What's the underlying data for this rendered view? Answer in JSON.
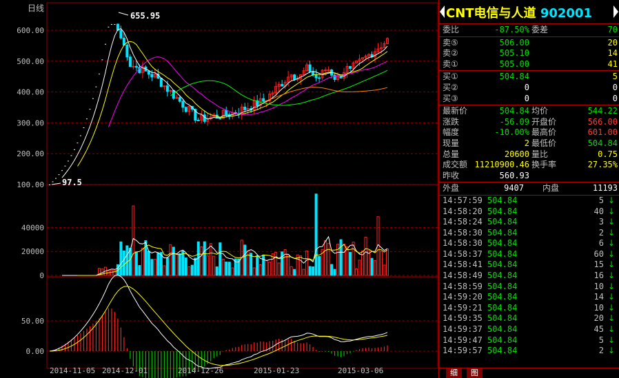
{
  "chart": {
    "period_label": "日线",
    "price_axis": [
      "600.00",
      "500.00",
      "400.00",
      "300.00",
      "200.00",
      "100.00"
    ],
    "volume_axis": [
      "40000",
      "20000",
      "0"
    ],
    "macd_axis": [
      "50.00",
      "0.00"
    ],
    "high_label": "655.95",
    "low_label": "97.5",
    "dates": [
      "2014-11-05",
      "2014-12-01",
      "2014-12-26",
      "2015-01-23",
      "2015-03-06"
    ],
    "colors": {
      "up": "#ff2020",
      "down": "#00e5ff",
      "ma5": "#ffffff",
      "ma10": "#ffff00",
      "ma20": "#ff00ff",
      "ma60": "#00ff00",
      "ma120": "#ff8000",
      "grid": "#8b0000"
    }
  },
  "quote": {
    "name": "CNT电信与人道",
    "code": "902001",
    "weibi_label": "委比",
    "weibi": "-87.50%",
    "weicha_label": "委差",
    "weicha": "70",
    "sell": [
      {
        "label": "卖⑤",
        "price": "506.00",
        "vol": "20"
      },
      {
        "label": "卖②",
        "price": "505.10",
        "vol": "14"
      },
      {
        "label": "卖①",
        "price": "505.00",
        "vol": "41"
      }
    ],
    "buy": [
      {
        "label": "买①",
        "price": "504.84",
        "vol": "5"
      },
      {
        "label": "买②",
        "price": "0",
        "vol": "0"
      },
      {
        "label": "买③",
        "price": "0",
        "vol": "0"
      }
    ],
    "stats": [
      {
        "l1": "最新价",
        "v1": "504.84",
        "l2": "均价",
        "v2": "544.22"
      },
      {
        "l1": "涨跌",
        "v1": "-56.09",
        "l2": "开盘价",
        "v2": "566.00"
      },
      {
        "l1": "幅度",
        "v1": "-10.00%",
        "l2": "最高价",
        "v2": "601.00"
      },
      {
        "l1": "现量",
        "v1": "2",
        "l2": "最低价",
        "v2": "504.84"
      },
      {
        "l1": "总量",
        "v1": "20600",
        "l2": "量比",
        "v2": "0.75"
      },
      {
        "l1": "成交额",
        "v1": "11210900.46",
        "l2": "换手率",
        "v2": "27.35%"
      }
    ],
    "prev_close_label": "昨收",
    "prev_close": "560.93",
    "outer_label": "外盘",
    "outer": "9407",
    "inner_label": "内盘",
    "inner": "11193"
  },
  "ticks": [
    {
      "time": "14:57:59",
      "price": "504.84",
      "vol": "5",
      "dir": "↓"
    },
    {
      "time": "14:58:20",
      "price": "504.84",
      "vol": "40",
      "dir": "↓"
    },
    {
      "time": "14:58:24",
      "price": "504.84",
      "vol": "3",
      "dir": "↓"
    },
    {
      "time": "14:58:30",
      "price": "504.84",
      "vol": "2",
      "dir": "↓"
    },
    {
      "time": "14:58:30",
      "price": "504.84",
      "vol": "6",
      "dir": "↓"
    },
    {
      "time": "14:58:37",
      "price": "504.84",
      "vol": "60",
      "dir": "↓"
    },
    {
      "time": "14:58:41",
      "price": "504.84",
      "vol": "15",
      "dir": "↓"
    },
    {
      "time": "14:58:49",
      "price": "504.84",
      "vol": "16",
      "dir": "↓"
    },
    {
      "time": "14:58:59",
      "price": "504.84",
      "vol": "10",
      "dir": "↓"
    },
    {
      "time": "14:59:20",
      "price": "504.84",
      "vol": "14",
      "dir": "↓"
    },
    {
      "time": "14:59:21",
      "price": "504.84",
      "vol": "10",
      "dir": "↓"
    },
    {
      "time": "14:59:35",
      "price": "504.84",
      "vol": "20",
      "dir": "↓"
    },
    {
      "time": "14:59:37",
      "price": "504.84",
      "vol": "45",
      "dir": "↓"
    },
    {
      "time": "14:59:47",
      "price": "504.84",
      "vol": "5",
      "dir": "↓"
    },
    {
      "time": "14:59:57",
      "price": "504.84",
      "vol": "2",
      "dir": "↓"
    }
  ],
  "tabs": {
    "detail": "细",
    "chart": "图"
  }
}
